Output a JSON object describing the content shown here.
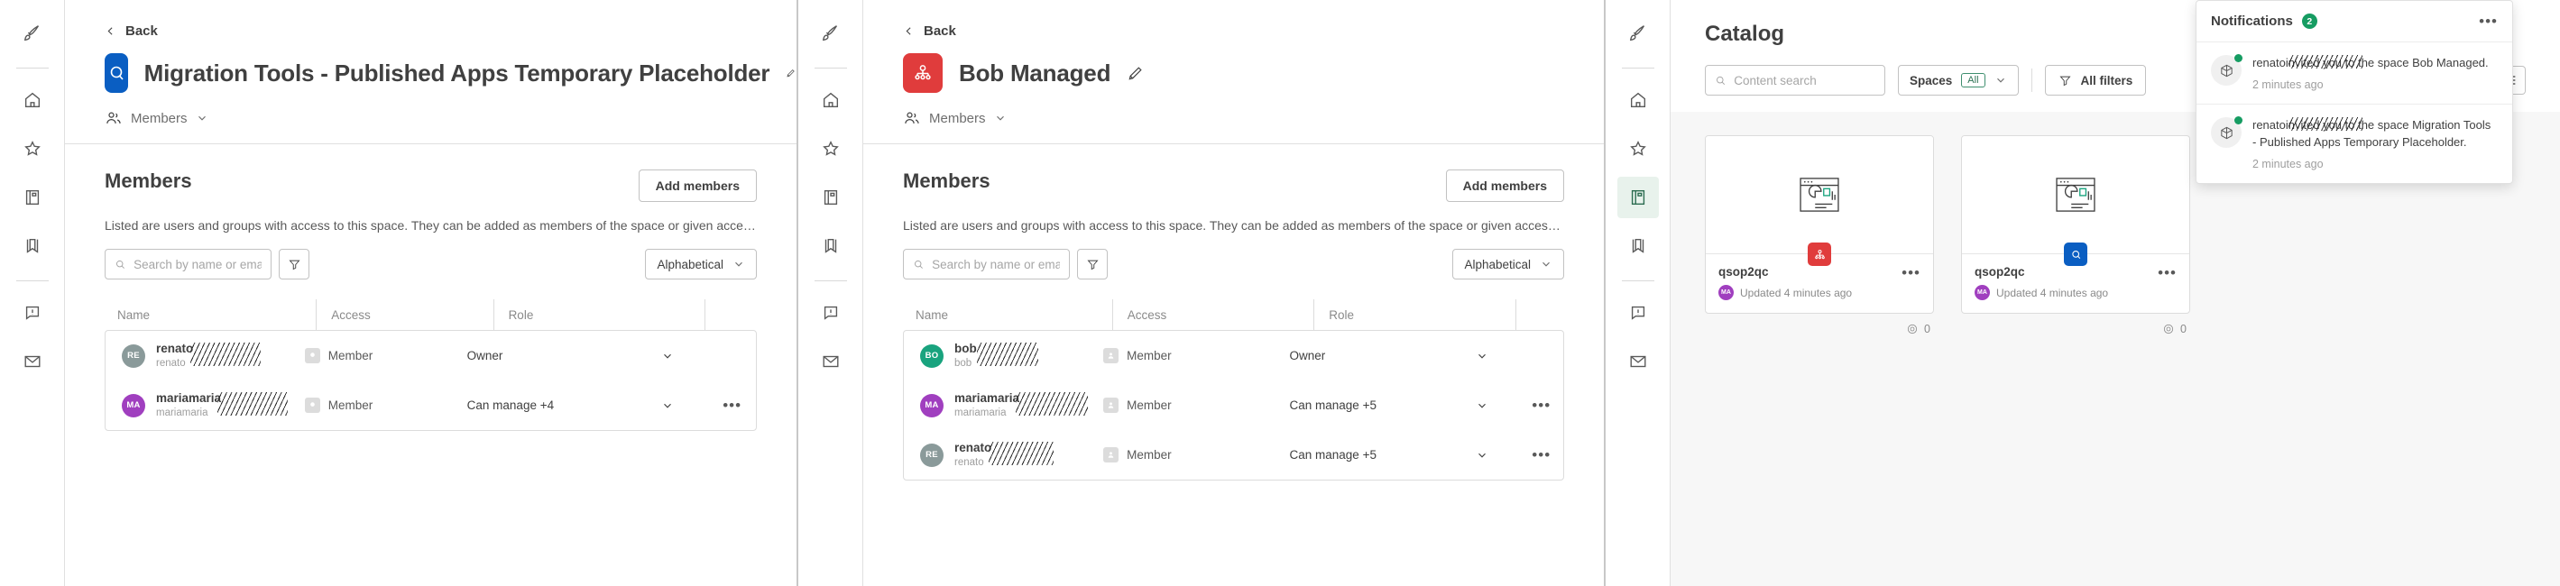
{
  "rail": {
    "icons": [
      "rocket-icon",
      "home-icon",
      "star-icon",
      "book-icon",
      "bookmark-icon",
      "alert-icon",
      "mail-icon"
    ]
  },
  "panel1": {
    "back_label": "Back",
    "space_title": "Migration Tools - Published Apps Temporary Placeholder",
    "space_avatar_color": "#0a5ec2",
    "space_avatar_icon": "qlik-space-icon",
    "tab_label": "Members",
    "section_title": "Members",
    "add_members_label": "Add members",
    "description": "Listed are users and groups with access to this space. They can be added as members of the space or given access to spe...",
    "search_placeholder": "Search by name or email",
    "search_value": "",
    "filter_icon": "funnel-icon",
    "sort_label": "Alphabetical",
    "columns": [
      "Name",
      "Access",
      "Role",
      ""
    ],
    "rows": [
      {
        "initials": "RE",
        "avatar_color": "#8a9a9a",
        "name": "renato",
        "sub": "renato",
        "redacted": true,
        "access": "Member",
        "role": "Owner",
        "has_menu": false
      },
      {
        "initials": "MA",
        "avatar_color": "#a03fbf",
        "name": "mariamaria",
        "sub": "mariamaria",
        "redacted": true,
        "access": "Member",
        "role": "Can manage +4",
        "has_menu": true
      }
    ]
  },
  "panel2": {
    "back_label": "Back",
    "space_title": "Bob Managed",
    "space_avatar_color": "#e03c3c",
    "space_avatar_icon": "managed-space-icon",
    "tab_label": "Members",
    "section_title": "Members",
    "add_members_label": "Add members",
    "description": "Listed are users and groups with access to this space. They can be added as members of the space or given access to specific content.",
    "search_placeholder": "Search by name or email",
    "search_value": "",
    "filter_icon": "funnel-icon",
    "sort_label": "Alphabetical",
    "columns": [
      "Name",
      "Access",
      "Role",
      ""
    ],
    "rows": [
      {
        "initials": "BO",
        "avatar_color": "#19a37e",
        "name": "bob",
        "sub": "bob",
        "redacted": true,
        "access": "Member",
        "role": "Owner",
        "has_menu": false
      },
      {
        "initials": "MA",
        "avatar_color": "#a03fbf",
        "name": "mariamaria",
        "sub": "mariamaria",
        "redacted": true,
        "access": "Member",
        "role": "Can manage +5",
        "has_menu": true
      },
      {
        "initials": "RE",
        "avatar_color": "#8a9a9a",
        "name": "renato",
        "sub": "renato",
        "redacted": true,
        "access": "Member",
        "role": "Can manage +5",
        "has_menu": true
      }
    ]
  },
  "catalog": {
    "title": "Catalog",
    "search_placeholder": "Content search",
    "search_value": "",
    "spaces_label": "Spaces",
    "spaces_pill": "All",
    "all_filters_label": "All filters",
    "view_grid_icon": "grid-view-icon",
    "view_list_icon": "list-view-icon",
    "selected_view": "grid",
    "cards": [
      {
        "name": "qsop2qc",
        "owner_initials": "MA",
        "owner_color": "#a03fbf",
        "updated": "Updated 4 minutes ago",
        "badge_color": "#e03c3c",
        "badge_icon": "managed-space-icon",
        "thumb_icon": "app-chart-icon",
        "views": "0"
      },
      {
        "name": "qsop2qc",
        "owner_initials": "MA",
        "owner_color": "#a03fbf",
        "updated": "Updated 4 minutes ago",
        "badge_color": "#0a5ec2",
        "badge_icon": "qlik-space-icon",
        "thumb_icon": "app-chart-icon",
        "views": "0"
      }
    ]
  },
  "notifications": {
    "title": "Notifications",
    "count": "2",
    "more_icon": "ellipsis-icon",
    "items": [
      {
        "actor": "renato",
        "text_tail": "invited you to the space Bob Managed.",
        "time": "2 minutes ago",
        "unread": true,
        "icon": "cube-icon"
      },
      {
        "actor": "renato",
        "text_tail": "invited you to the space Migration Tools - Published Apps Temporary Placeholder.",
        "time": "2 minutes ago",
        "unread": true,
        "icon": "cube-icon"
      }
    ]
  }
}
